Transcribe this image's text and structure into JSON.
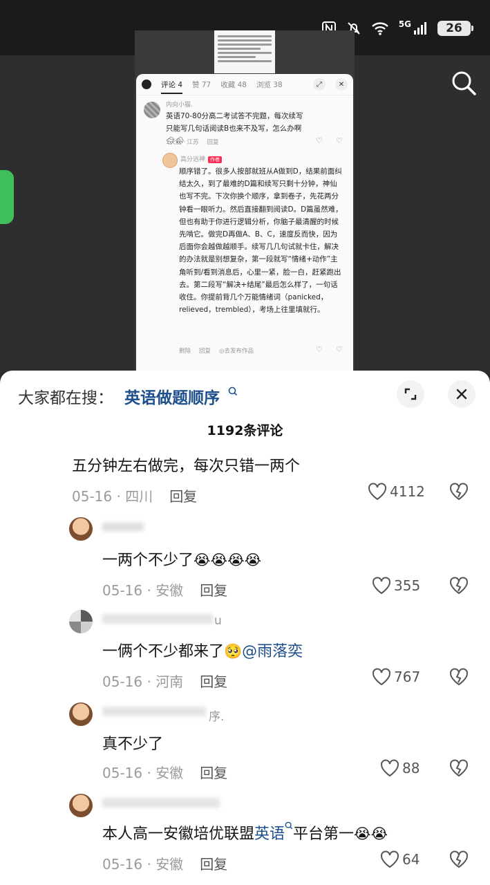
{
  "status_bar": {
    "battery": "26",
    "network": "5G"
  },
  "embedded": {
    "tabs": [
      {
        "label": "评论 4"
      },
      {
        "label": "赞 77"
      },
      {
        "label": "收藏 48"
      },
      {
        "label": "浏览 38"
      }
    ],
    "comment1": {
      "user": "内向小猫.",
      "text": "英语70-80分高二考试答不完题，每次续写只能写几句话阅读B也来不及写，怎么办啊🌧🌧",
      "time": "1天前 · 江苏",
      "reply": "回复"
    },
    "comment2": {
      "user": "高分远神",
      "tag": "作者",
      "text": "顺序错了。很多人按部就班从A做到D，结果前面纠结太久，到了最难的D篇和续写只剩十分钟，神仙也写不完。下次你换个顺序，拿到卷子，先花两分钟看一眼听力。然后直接翻到阅读D。D篇虽然难，但也有助于你进行逻辑分析，你脑子最清醒的时候先啃它。做完D再做A、B、C，速度反而快，因为后面你会越做越顺手。续写几几句试就卡住，解决的办法就是别想复杂，第一段就写“情绪+动作”主角听到/看到消息后，心里一紧，脸一白，赶紧跑出去。第二段写“解决+结尾”最后怎么样了，一句话收住。你提前背几个万能情绪词（panicked，relieved，trembled），考场上往里填就行。",
      "delete": "删除",
      "reply": "回复",
      "publish": "◎去发布作品"
    }
  },
  "sheet": {
    "suggest_label": "大家都在搜：",
    "suggest_term": "英语做题顺序",
    "count": "1192条评论"
  },
  "comments": [
    {
      "user": "",
      "text": "五分钟左右做完，每次只错一两个",
      "date": "05-16 · 四川",
      "reply": "回复",
      "likes": "4112"
    },
    {
      "user": "      ",
      "text": "一两个不少了",
      "emojis": "😭😭😭😭",
      "date": "05-16 · 安徽",
      "reply": "回复",
      "likes": "355"
    },
    {
      "user": "u",
      "text": "一俩个不少都来了",
      "emoji": "🥺",
      "mention": "@雨落奕",
      "date": "05-16 · 河南",
      "reply": "回复",
      "likes": "767"
    },
    {
      "user": "序.",
      "text": "真不少了",
      "date": "05-16 · 安徽",
      "reply": "回复",
      "likes": "88"
    },
    {
      "user": "",
      "text_a": "本人高一安徽培优联盟",
      "link": "英语",
      "text_b": "平台第一",
      "emojis": "😭😭",
      "date": "05-16 · 安徽",
      "reply": "回复",
      "likes": "64"
    }
  ]
}
